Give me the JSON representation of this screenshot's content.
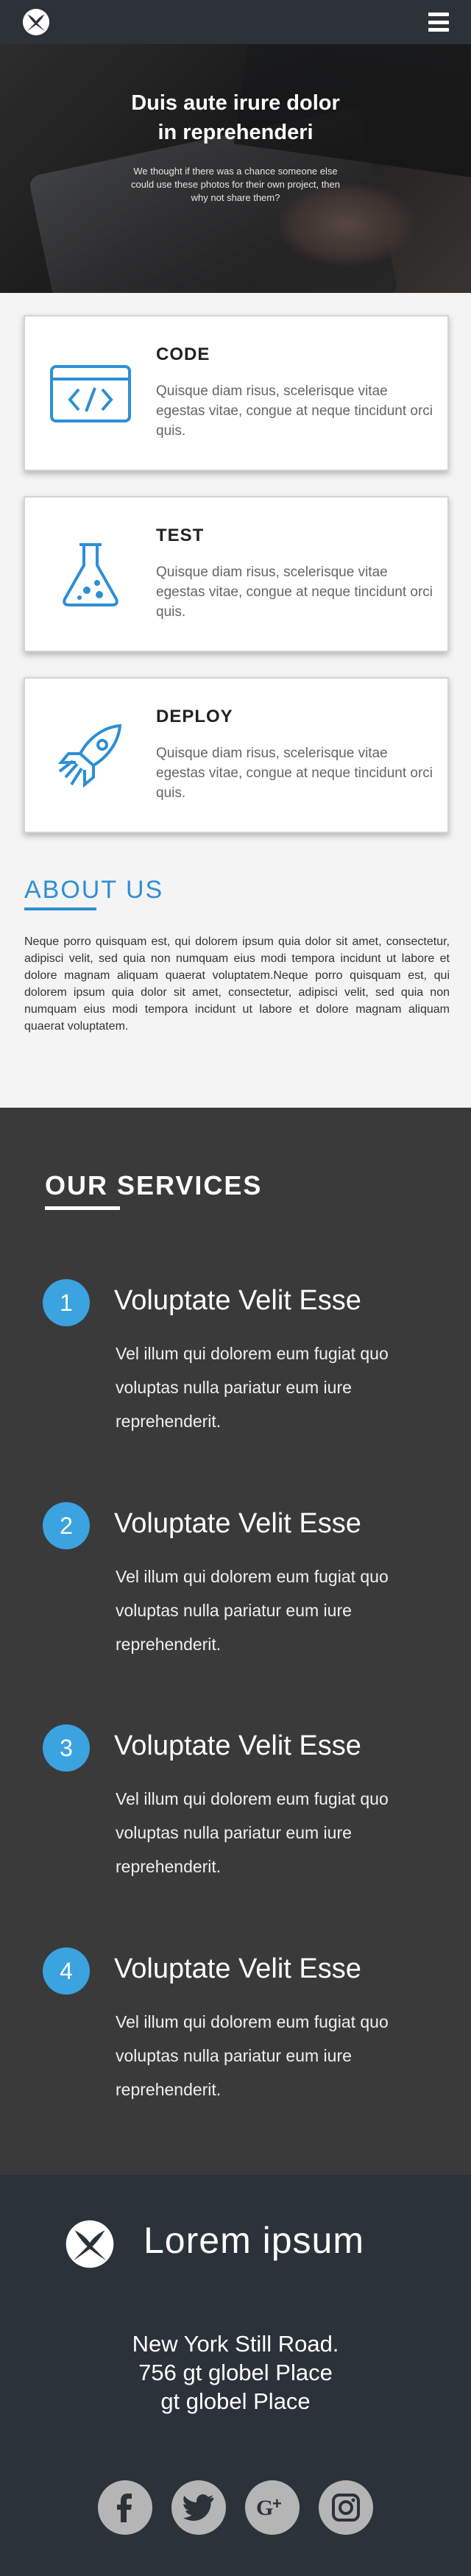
{
  "header": {
    "logo_icon": "xbox-logo-icon",
    "menu_icon": "hamburger-menu-icon"
  },
  "hero": {
    "title_line1": "Duis aute irure dolor",
    "title_line2": "in reprehenderi",
    "subtitle": "We thought if there was a chance someone else could use these photos for their own project, then why not share them?"
  },
  "features": [
    {
      "title": "CODE",
      "text": "Quisque diam risus, scelerisque vitae egestas vitae, congue at neque tincidunt orci quis.",
      "icon": "code-window-icon"
    },
    {
      "title": "TEST",
      "text": "Quisque diam risus, scelerisque vitae egestas vitae, congue at neque tincidunt orci quis.",
      "icon": "flask-icon"
    },
    {
      "title": "DEPLOY",
      "text": "Quisque diam risus, scelerisque vitae egestas vitae, congue at neque tincidunt orci quis.",
      "icon": "rocket-icon"
    }
  ],
  "about": {
    "title": "ABOUT US",
    "text": "Neque porro quisquam est, qui dolorem ipsum quia dolor sit amet, consectetur, adipisci velit, sed quia non numquam eius modi tempora incidunt ut labore et dolore magnam aliquam quaerat voluptatem.Neque porro quisquam est, qui dolorem ipsum quia dolor sit amet, consectetur, adipisci velit, sed quia non numquam eius modi tempora incidunt ut labore et dolore magnam aliquam quaerat voluptatem."
  },
  "services": {
    "title": "OUR SERVICES",
    "items": [
      {
        "number": "1",
        "heading": "Voluptate Velit Esse",
        "text": "Vel illum qui dolorem eum fugiat quo voluptas nulla pariatur eum iure reprehenderit."
      },
      {
        "number": "2",
        "heading": "Voluptate Velit Esse",
        "text": "Vel illum qui dolorem eum fugiat quo voluptas nulla pariatur eum iure reprehenderit."
      },
      {
        "number": "3",
        "heading": "Voluptate Velit Esse",
        "text": "Vel illum qui dolorem eum fugiat quo voluptas nulla pariatur eum iure reprehenderit."
      },
      {
        "number": "4",
        "heading": "Voluptate Velit Esse",
        "text": "Vel illum qui dolorem eum fugiat quo voluptas nulla pariatur eum iure reprehenderit."
      }
    ]
  },
  "footer": {
    "brand": "Lorem ipsum",
    "logo_icon": "xbox-logo-icon",
    "address_line1": "New York Still Road.",
    "address_line2": "756 gt globel Place",
    "address_line3": "gt globel Place",
    "socials": [
      {
        "name": "facebook-icon"
      },
      {
        "name": "twitter-icon"
      },
      {
        "name": "google-plus-icon"
      },
      {
        "name": "instagram-icon"
      }
    ]
  },
  "colors": {
    "accent": "#2d8fd5",
    "topbar": "#2d3239",
    "services_bg": "#3a3a3a",
    "footer_bg": "#2c323a",
    "service_number_bg": "#3aa3e0"
  }
}
